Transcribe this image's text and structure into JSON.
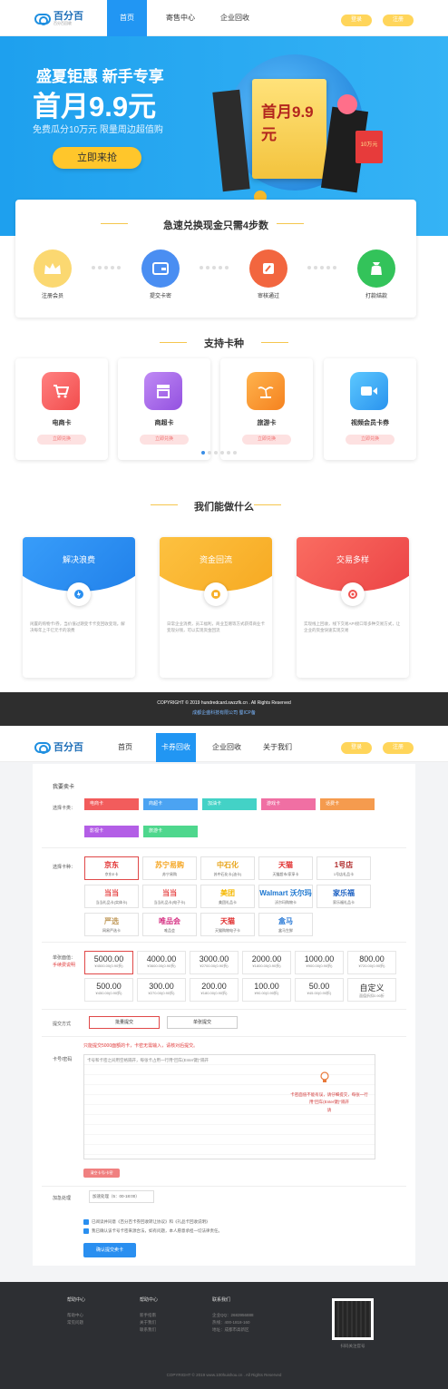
{
  "top_nav": {
    "logo": "百分百",
    "logo_sub": "百分百回收",
    "items": [
      "首页",
      "寄售中心",
      "企业回收"
    ],
    "login": "登录",
    "register": "注册"
  },
  "hero": {
    "title": "盛夏钜惠  新手专享",
    "big": "首月9.9元",
    "sub": "免费瓜分10万元  限量周边超值购",
    "cta": "立即来抢",
    "card_text": "首月9.9元",
    "tag": "10万元"
  },
  "steps": {
    "title": "急速兑换现金只需4步数",
    "items": [
      {
        "label": "注册会员",
        "icon": "crown-icon",
        "color": "#f9c94e"
      },
      {
        "label": "提交卡密",
        "icon": "card-icon",
        "color": "#4a8ef2"
      },
      {
        "label": "审核通过",
        "icon": "pencil-icon",
        "color": "#f2663f"
      },
      {
        "label": "打款结款",
        "icon": "money-bag-icon",
        "color": "#33c35a"
      }
    ]
  },
  "support": {
    "title": "支持卡种",
    "items": [
      {
        "name": "电商卡",
        "btn": "立即兑换",
        "color": "#f26262",
        "icon": "cart-icon"
      },
      {
        "name": "商超卡",
        "btn": "立即兑换",
        "color": "#a064e8",
        "icon": "store-icon"
      },
      {
        "name": "旅游卡",
        "btn": "立即兑换",
        "color": "#f7902e",
        "icon": "palm-icon"
      },
      {
        "name": "视频会员卡券",
        "btn": "立即兑换",
        "color": "#34a8f0",
        "icon": "video-icon"
      }
    ]
  },
  "features": {
    "title": "我们能做什么",
    "items": [
      {
        "name": "解决浪费",
        "color": "#2a8ff0",
        "desc": "闲置的购物卡/券，当价值过期变卡卡变回收变现。解决每年上千亿元卡的浪费"
      },
      {
        "name": "资金回流",
        "color": "#f7b02c",
        "desc": "日常企业消费，员工福利，商业互赠等方式获得商业卡变现分钱，可以实现资金回流"
      },
      {
        "name": "交易多样",
        "color": "#f0524f",
        "desc": "实现线上回收，线下交易API接口等多种交易方式，让企业的资金快速实现交易"
      }
    ]
  },
  "copyright": {
    "line1": "COPYRIGHT © 2019 hundredcard.swzzfk.cn . All Rights Reserved",
    "line2": "成都企盛科技有限公司 蜀ICP备"
  },
  "sell_nav": {
    "items": [
      "首页",
      "卡券回收",
      "企业回收",
      "关于我们"
    ],
    "login": "登录",
    "register": "注册"
  },
  "sell": {
    "heading": "我要卖卡",
    "card_type_label": "选择卡类：",
    "card_types": [
      {
        "name": "电商卡",
        "color": "#f25c5c"
      },
      {
        "name": "商超卡",
        "color": "#4ba3f2"
      },
      {
        "name": "加油卡",
        "color": "#43d2c6"
      },
      {
        "name": "游戏卡",
        "color": "#f06fa3"
      },
      {
        "name": "话费卡",
        "color": "#f59b4e"
      },
      {
        "name": "影视卡",
        "color": "#b35ee6"
      },
      {
        "name": "旅游卡",
        "color": "#4ed78d"
      }
    ],
    "brand_label": "选择卡种：",
    "brands": [
      {
        "logo": "京东",
        "name": "京东E卡",
        "color": "#e02b2b"
      },
      {
        "logo": "苏宁易购",
        "name": "苏宁易购",
        "color": "#f5a623"
      },
      {
        "logo": "中石化",
        "name": "苏中石化卡(油卡)",
        "color": "#e7a317"
      },
      {
        "logo": "天猫",
        "name": "天猫超市/家享卡",
        "color": "#e02b2b"
      },
      {
        "logo": "1号店",
        "name": "1号店礼品卡",
        "color": "#b02b2b"
      },
      {
        "logo": "当当",
        "name": "当当礼品卡(实体卡)",
        "color": "#e64545"
      },
      {
        "logo": "当当",
        "name": "当当礼品卡(电子卡)",
        "color": "#e64545"
      },
      {
        "logo": "美团",
        "name": "美团礼品卡",
        "color": "#f5b800"
      },
      {
        "logo": "Walmart 沃尔玛",
        "name": "沃尔玛购物卡",
        "color": "#1a75cf"
      },
      {
        "logo": "家乐福",
        "name": "家乐福礼品卡",
        "color": "#1a5fc2"
      },
      {
        "logo": "严选",
        "name": "网易严选卡",
        "color": "#c19a5b"
      },
      {
        "logo": "唯品会",
        "name": "唯品会",
        "color": "#d63384"
      },
      {
        "logo": "天猫",
        "name": "天猫购物电子卡",
        "color": "#e02b2b"
      },
      {
        "logo": "盒马",
        "name": "盒马生鲜",
        "color": "#2a7ad6"
      }
    ],
    "denom_label": "单张面值：",
    "denom_note": "手续费说明",
    "amounts": [
      {
        "v": "5000.00",
        "s": "¥4500.00(0.90折)"
      },
      {
        "v": "4000.00",
        "s": "¥3600.00(0.90折)"
      },
      {
        "v": "3000.00",
        "s": "¥2700.00(0.90折)"
      },
      {
        "v": "2000.00",
        "s": "¥1800.00(0.90折)"
      },
      {
        "v": "1000.00",
        "s": "¥900.00(0.90折)"
      },
      {
        "v": "800.00",
        "s": "¥720.00(0.90折)"
      },
      {
        "v": "500.00",
        "s": "¥450.00(0.90折)"
      },
      {
        "v": "300.00",
        "s": "¥270.00(0.90折)"
      },
      {
        "v": "200.00",
        "s": "¥180.00(0.90折)"
      },
      {
        "v": "100.00",
        "s": "¥90.00(0.90折)"
      },
      {
        "v": "50.00",
        "s": "¥45.00(0.90折)"
      },
      {
        "v": "自定义",
        "s": "面值折扣0.90折"
      }
    ],
    "submit_way_label": "提交方式",
    "submit_ways": [
      "批量提交",
      "单张提交"
    ],
    "notice": "只能提交5000面额的卡，卡密无需输入，请核对后提交。",
    "code_label": "卡号/密码",
    "textarea_hint": "卡号和卡密之间用空格隔开，每张卡占用一行用\"回车(Enter键)\"隔开",
    "tip": "卡密面值不能有误，请仔细提交，每张一行用\"回车(Enter键)\"隔开",
    "tip2": "请",
    "clear_btn": "清空卡号/卡密",
    "speed_label": "加急处理",
    "speed_value": "加速处理（5：00-18:00）",
    "agree1": "已阅读并同意《百分百卡券回收转让协议》和《礼品卡回收说明》",
    "agree2": "我已确认该卡号卡密来源合法，如有问题，本人愿意承担一切法律责任。",
    "confirm": "确认提交卖卡"
  },
  "bottom_footer": {
    "cols": [
      {
        "title": "帮助中心",
        "items": [
          "帮助中心",
          "常见问题"
        ]
      },
      {
        "title": "帮助中心",
        "items": [
          "新手指南",
          "关于我们",
          "联系我们"
        ]
      },
      {
        "title": "联系我们",
        "items": [
          "企业QQ：2683956888",
          "热线：400-1818-160",
          "地址：成都市高新区"
        ]
      }
    ],
    "qr_caption": "扫码关注官号",
    "copyright": "COPYRIGHT © 2019 www.100huishou.cn . All Rights Reserved"
  }
}
